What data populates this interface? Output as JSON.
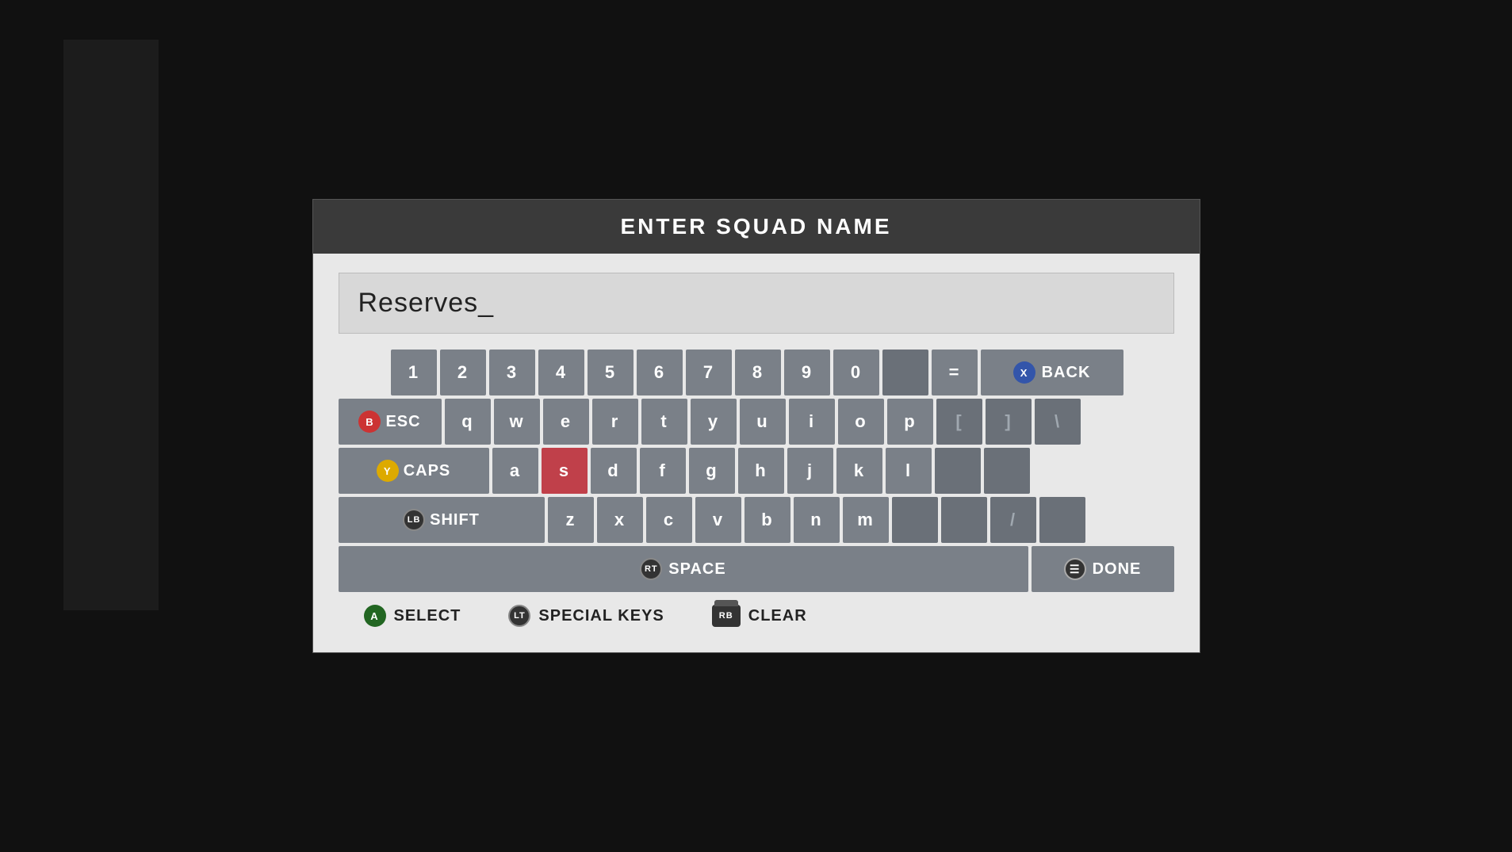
{
  "modal": {
    "title": "ENTER SQUAD NAME",
    "input_value": "Reserves_"
  },
  "keyboard": {
    "row_numbers": [
      "1",
      "2",
      "3",
      "4",
      "5",
      "6",
      "7",
      "8",
      "9",
      "0",
      "",
      "="
    ],
    "row1": [
      "q",
      "w",
      "e",
      "r",
      "t",
      "y",
      "u",
      "i",
      "o",
      "p",
      "[",
      "]",
      "\\"
    ],
    "row2": [
      "a",
      "s",
      "d",
      "f",
      "g",
      "h",
      "j",
      "k",
      "l",
      "",
      ""
    ],
    "row3": [
      "z",
      "x",
      "c",
      "v",
      "b",
      "n",
      "m",
      "",
      "",
      "",
      ""
    ],
    "active_key": "s",
    "back_label": "BACK",
    "esc_label": "ESC",
    "caps_label": "CAPS",
    "shift_label": "SHIFT",
    "space_label": "SPACE",
    "done_label": "DONE"
  },
  "footer": {
    "select_label": "SELECT",
    "special_keys_label": "SPECIAL KEYS",
    "clear_label": "CLEAR"
  },
  "controller_buttons": {
    "b": "B",
    "y": "Y",
    "lb": "LB",
    "rt": "RT",
    "a": "A",
    "lt": "LT",
    "rb": "RB",
    "x": "X",
    "menu": "☰"
  }
}
